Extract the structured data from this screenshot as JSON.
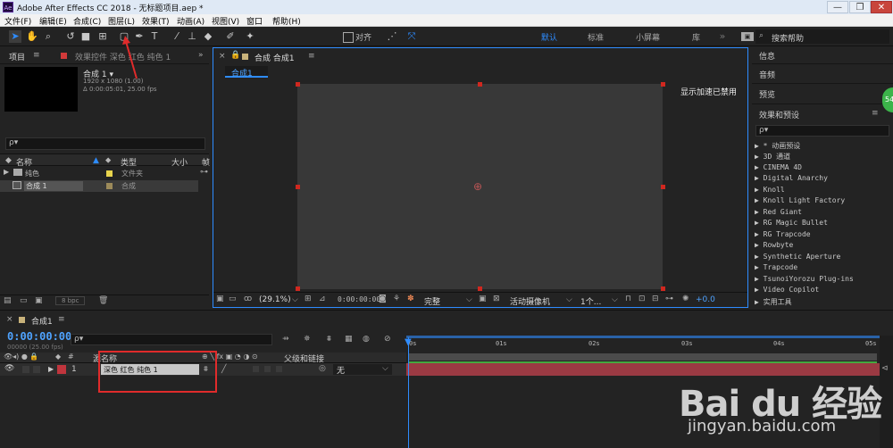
{
  "window": {
    "app_icon": "Ae",
    "title": "Adobe After Effects CC 2018 - 无标题项目.aep *",
    "controls": [
      "—",
      "❐",
      "✕"
    ]
  },
  "menu": [
    "文件(F)",
    "编辑(E)",
    "合成(C)",
    "图层(L)",
    "效果(T)",
    "动画(A)",
    "视图(V)",
    "窗口",
    "帮助(H)"
  ],
  "toolbar": {
    "snap_label": "对齐",
    "workspaces": [
      "默认",
      "标准",
      "小屏幕",
      "库"
    ],
    "search_placeholder": "搜索帮助"
  },
  "project": {
    "tab": "项目",
    "effects_tab": "效果控件 深色 红色 纯色 1",
    "comp_name": "合成 1 ▾",
    "comp_res": "1920 x 1080 (1.00)",
    "comp_dur": "Δ 0:00:05:01, 25.00 fps",
    "search_icon": "ρ▾",
    "columns": [
      "名称",
      "类型",
      "大小",
      "帧"
    ],
    "items": [
      {
        "name": "纯色",
        "type": "文件夹",
        "color": "#e8d44d"
      },
      {
        "name": "合成 1",
        "type": "合成",
        "color": "#9c8a5a"
      }
    ],
    "bpc": "8 bpc"
  },
  "comp": {
    "tab": "合成 合成1",
    "sub_tab": "合成1",
    "gpu_notice": "显示加速已禁用",
    "zoom": "(29.1%)",
    "timecode": "0:00:00:00",
    "quality": "完整",
    "camera": "活动摄像机",
    "views": "1个...",
    "exposure": "+0.0"
  },
  "right_panels": {
    "info": "信息",
    "audio": "音频",
    "preview": "预览",
    "effects_presets": "效果和预设",
    "effects_search": "ρ▾",
    "effects": [
      "▶ * 动画预设",
      "▶ 3D 通道",
      "▶ CINEMA 4D",
      "▶ Digital Anarchy",
      "▶ Knoll",
      "▶ Knoll Light Factory",
      "▶ Red Giant",
      "▶ RG Magic Bullet",
      "▶ RG Trapcode",
      "▶ Rowbyte",
      "▶ Synthetic Aperture",
      "▶ Trapcode",
      "▶ TsunoiYorozu Plug-ins",
      "▶ Video Copilot",
      "▶ 实用工具"
    ],
    "badge": "54"
  },
  "timeline": {
    "tab": "合成1",
    "timecode": "0:00:00:00",
    "fps": "00000 (25.00 fps)",
    "search_icon": "ρ▾",
    "col_name": "源名称",
    "col_parent": "父级和链接",
    "layer_num": "1",
    "layer_name": "深色 红色 纯色 1",
    "parent_value": "无",
    "ruler": [
      "0s",
      "01s",
      "02s",
      "03s",
      "04s",
      "05s"
    ]
  },
  "watermark": {
    "brand": "Bai du 经验",
    "url": "jingyan.baidu.com"
  }
}
